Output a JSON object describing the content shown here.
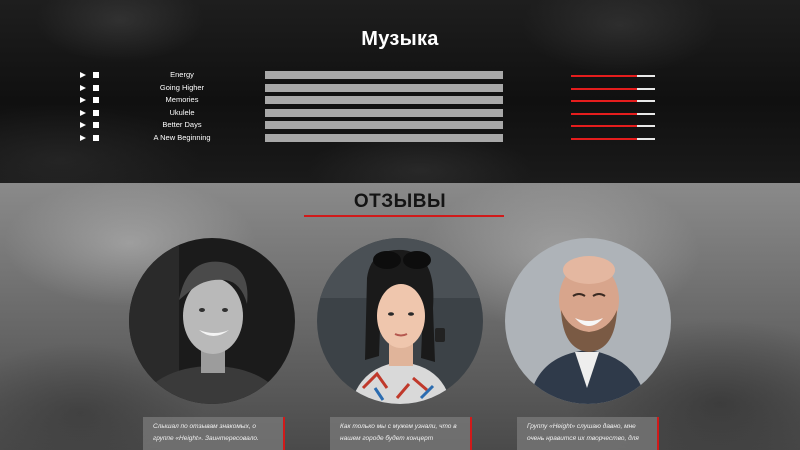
{
  "music": {
    "title": "Музыка",
    "tracks": [
      {
        "name": "Energy",
        "volume": 0.79
      },
      {
        "name": "Going Higher",
        "volume": 0.79
      },
      {
        "name": "Memories",
        "volume": 0.79
      },
      {
        "name": "Ukulele",
        "volume": 0.79
      },
      {
        "name": "Better Days",
        "volume": 0.79
      },
      {
        "name": "A New Beginning",
        "volume": 0.79
      }
    ]
  },
  "reviews": {
    "title": "ОТЗЫВЫ",
    "accent_color": "#d11a1a",
    "cards": [
      {
        "text": "Слышал по отзывам знакомых, о группе «Height». Заинтересовало."
      },
      {
        "text": "Как только мы с мужем узнали, что в нашем городе будет концерт"
      },
      {
        "text": "Группу «Height» слушаю давно, мне очень нравится их творчество, для"
      }
    ]
  }
}
